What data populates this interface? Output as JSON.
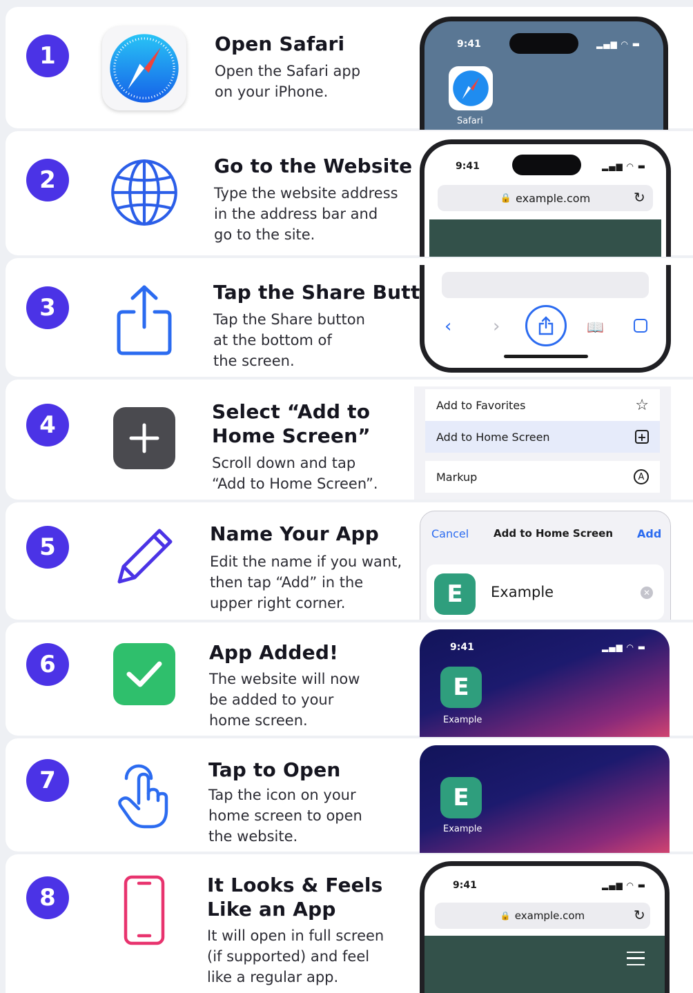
{
  "steps": [
    {
      "number": "1",
      "title_lines": [
        "Open Safari"
      ],
      "desc_lines": [
        "Open the Safari app",
        "on your iPhone."
      ],
      "icon": "safari-compass-icon"
    },
    {
      "number": "2",
      "title_lines": [
        "Go to the Website"
      ],
      "desc_lines": [
        "Type the website address",
        "in the address bar and",
        "go to the site."
      ],
      "icon": "globe-icon"
    },
    {
      "number": "3",
      "title_lines": [
        "Tap the Share Button"
      ],
      "desc_lines": [
        "Tap the Share button",
        "at the bottom of",
        "the screen."
      ],
      "icon": "share-icon"
    },
    {
      "number": "4",
      "title_lines": [
        "Select “Add to",
        "Home Screen”"
      ],
      "desc_lines": [
        "Scroll down and tap",
        "“Add to Home Screen”."
      ],
      "icon": "plus-square-icon"
    },
    {
      "number": "5",
      "title_lines": [
        "Name Your App"
      ],
      "desc_lines": [
        "Edit the name if you want,",
        "then tap “Add” in the",
        "upper right corner."
      ],
      "icon": "pencil-icon"
    },
    {
      "number": "6",
      "title_lines": [
        "App Added!"
      ],
      "desc_lines": [
        "The website will now",
        "be added to your",
        "home screen."
      ],
      "icon": "checkmark-icon"
    },
    {
      "number": "7",
      "title_lines": [
        "Tap to Open"
      ],
      "desc_lines": [
        "Tap the icon on your",
        "home screen to open",
        "the website."
      ],
      "icon": "tap-hand-icon"
    },
    {
      "number": "8",
      "title_lines": [
        "It Looks & Feels",
        "Like an App"
      ],
      "desc_lines": [
        "It will open in full screen",
        "(if supported) and feel",
        "like a regular app."
      ],
      "icon": "phone-icon"
    }
  ],
  "phone": {
    "time": "9:41",
    "status": "▂▄▆ ◠ ▬"
  },
  "shots": {
    "safari_label": "Safari",
    "url": "example.com",
    "menu": {
      "favorites": "Add to Favorites",
      "home_screen": "Add to Home Screen",
      "markup": "Markup"
    },
    "dialog": {
      "cancel": "Cancel",
      "title": "Add to Home Screen",
      "add": "Add",
      "app_letter": "E",
      "app_name": "Example"
    },
    "home_app_letter": "E",
    "home_app_name": "Example"
  },
  "colors": {
    "badge": "#4b33e6",
    "accent_blue": "#2b6bf0",
    "app_green": "#2f9e7d",
    "check_green": "#2fbf6c",
    "phone_pink": "#e8336e"
  }
}
